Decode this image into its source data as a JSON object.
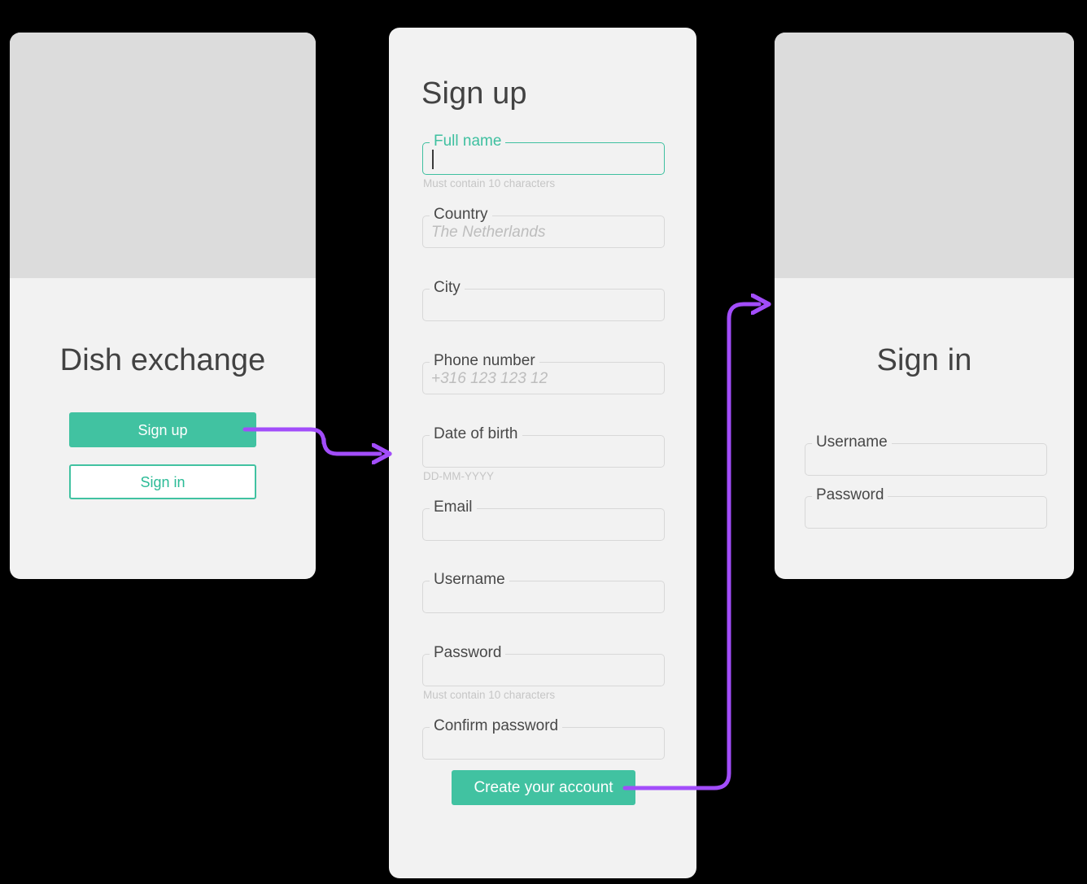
{
  "meta": {
    "accent_teal": "#41c2a1",
    "accent_teal_focus": "#3fc0a0",
    "arrow_purple": "#a24dfa",
    "card_bg": "#f2f2f2",
    "card_header_bg": "#dcdcdc",
    "canvas_bg": "#000000",
    "field_border": "#d8d8d8",
    "text_dark": "#424242",
    "placeholder_gray": "#bdbdbd",
    "helper_gray": "#c6c6c6"
  },
  "screens": {
    "welcome": {
      "title": "Dish exchange",
      "primary_button": "Sign up",
      "secondary_button": "Sign in"
    },
    "signup": {
      "title": "Sign up",
      "submit_button": "Create your account",
      "fields": [
        {
          "label": "Full name",
          "value": "",
          "helper": "Must contain 10 characters",
          "focused": true
        },
        {
          "label": "Country",
          "value": "The Netherlands",
          "helper": "",
          "focused": false
        },
        {
          "label": "City",
          "value": "",
          "helper": "",
          "focused": false
        },
        {
          "label": "Phone number",
          "value": "+316 123 123 12",
          "helper": "",
          "focused": false
        },
        {
          "label": "Date of birth",
          "value": "",
          "helper": "DD-MM-YYYY",
          "focused": false
        },
        {
          "label": "Email",
          "value": "",
          "helper": "",
          "focused": false
        },
        {
          "label": "Username",
          "value": "",
          "helper": "",
          "focused": false
        },
        {
          "label": "Password",
          "value": "",
          "helper": "Must contain 10 characters",
          "focused": false
        },
        {
          "label": "Confirm password",
          "value": "",
          "helper": "",
          "focused": false
        }
      ]
    },
    "signin": {
      "title": "Sign in",
      "fields": [
        {
          "label": "Username",
          "value": "",
          "helper": "",
          "focused": false
        },
        {
          "label": "Password",
          "value": "",
          "helper": "",
          "focused": false
        }
      ]
    }
  },
  "flow": {
    "connectors": [
      {
        "name": "signup-button-to-signup-screen",
        "from": "welcome.primary_button",
        "to": "signup"
      },
      {
        "name": "create-account-to-signin-screen",
        "from": "signup.submit_button",
        "to": "signin"
      }
    ]
  }
}
